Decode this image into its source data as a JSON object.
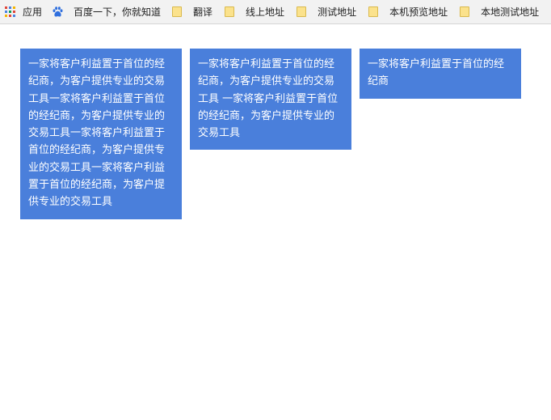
{
  "bookmarks_bar": {
    "apps_label": "应用",
    "baidu_label": "百度一下，你就知道",
    "folders": [
      "翻译",
      "线上地址",
      "测试地址",
      "本机预览地址",
      "本地测试地址"
    ]
  },
  "cards": [
    "一家将客户利益置于首位的经纪商，为客户提供专业的交易工具一家将客户利益置于首位的经纪商，为客户提供专业的交易工具一家将客户利益置于首位的经纪商，为客户提供专业的交易工具一家将客户利益置于首位的经纪商，为客户提供专业的交易工具",
    "一家将客户利益置于首位的经纪商，为客户提供专业的交易工具 一家将客户利益置于首位的经纪商，为客户提供专业的交易工具",
    "一家将客户利益置于首位的经纪商"
  ],
  "colors": {
    "card_background": "#4a7fdb",
    "card_text": "#ffffff",
    "bar_background": "#f2f2f2",
    "folder": "#fbe28c"
  },
  "icons": {
    "apps": "apps-grid-icon",
    "baidu": "baidu-paw-icon",
    "folder": "folder-icon"
  }
}
